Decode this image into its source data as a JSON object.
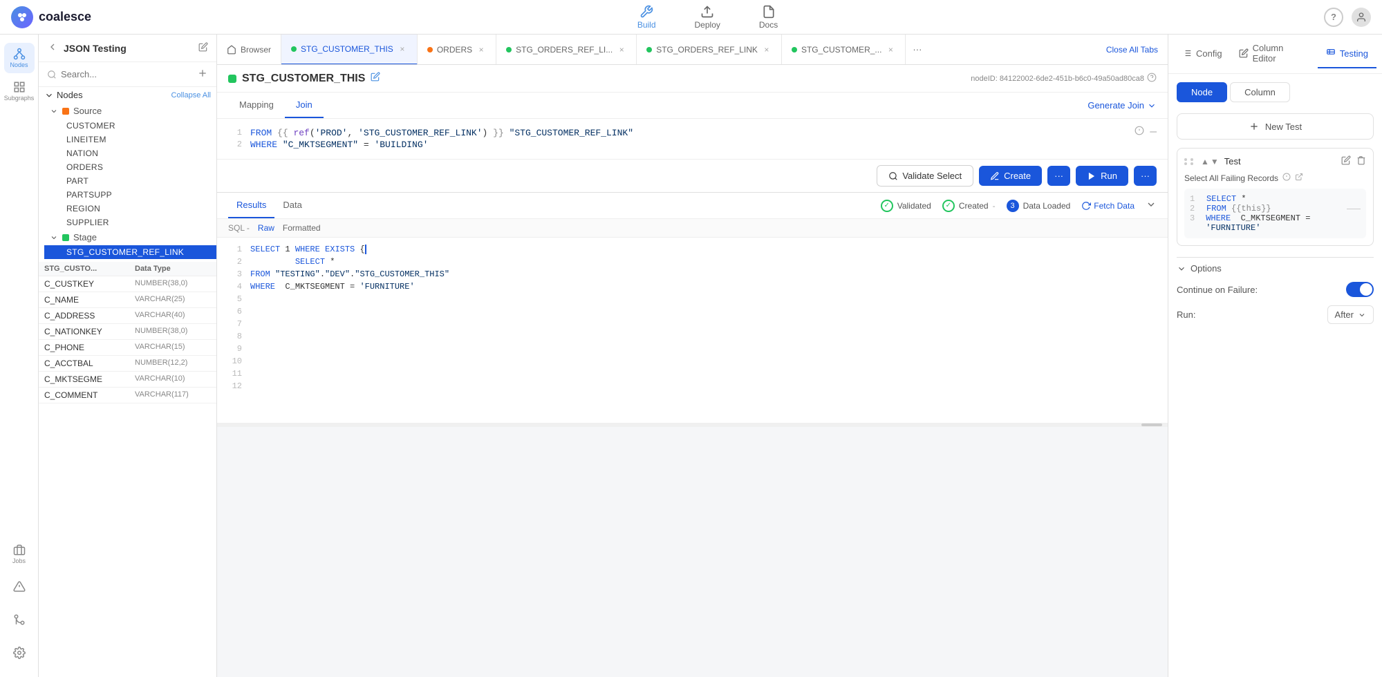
{
  "app": {
    "logo_text": "coalesce",
    "project_name": "JSON Testing"
  },
  "top_nav": {
    "build_label": "Build",
    "deploy_label": "Deploy",
    "docs_label": "Docs"
  },
  "sidebar": {
    "search_placeholder": "Search...",
    "nodes_label": "Nodes",
    "collapse_all_label": "Collapse All",
    "source_label": "Source",
    "stage_label": "Stage",
    "source_items": [
      "CUSTOMER",
      "LINEITEM",
      "NATION",
      "ORDERS",
      "PART",
      "PARTSUPP",
      "REGION",
      "SUPPLIER"
    ],
    "active_node": "STG_CUSTOMER_REF_LINK"
  },
  "table_header": {
    "col1": "STG_CUSTO...",
    "col2": "Data Type"
  },
  "table_rows": [
    {
      "col1": "C_CUSTKEY",
      "col2": "NUMBER(38,0)"
    },
    {
      "col1": "C_NAME",
      "col2": "VARCHAR(25)"
    },
    {
      "col1": "C_ADDRESS",
      "col2": "VARCHAR(40)"
    },
    {
      "col1": "C_NATIONKEY",
      "col2": "NUMBER(38,0)"
    },
    {
      "col1": "C_PHONE",
      "col2": "VARCHAR(15)"
    },
    {
      "col1": "C_ACCTBAL",
      "col2": "NUMBER(12,2)"
    },
    {
      "col1": "C_MKTSEGME",
      "col2": "VARCHAR(10)"
    },
    {
      "col1": "C_COMMENT",
      "col2": "VARCHAR(117)"
    }
  ],
  "tabs": [
    {
      "id": "browser",
      "label": "Browser",
      "dot_color": null,
      "closable": false
    },
    {
      "id": "stg_customer_this",
      "label": "STG_CUSTOMER_THIS",
      "dot_color": "#22c55e",
      "closable": true,
      "active": true
    },
    {
      "id": "orders",
      "label": "ORDERS",
      "dot_color": "#f97316",
      "closable": true
    },
    {
      "id": "stg_orders_ref_li",
      "label": "STG_ORDERS_REF_LI...",
      "dot_color": "#22c55e",
      "closable": true
    },
    {
      "id": "stg_orders_ref_link",
      "label": "STG_ORDERS_REF_LINK",
      "dot_color": "#22c55e",
      "closable": true
    },
    {
      "id": "stg_customer2",
      "label": "STG_CUSTOMER_...",
      "dot_color": "#22c55e",
      "closable": true
    }
  ],
  "close_all_label": "Close All Tabs",
  "editor": {
    "node_title": "STG_CUSTOMER_THIS",
    "node_id": "nodeID: 84122002-6de2-451b-b6c0-49a50ad80ca8",
    "mapping_tab": "Mapping",
    "join_tab": "Join",
    "active_tab": "Join",
    "generate_join_label": "Generate Join",
    "code_lines": [
      {
        "num": 1,
        "content": "FROM {{ ref('PROD', 'STG_CUSTOMER_REF_LINK') }} \"STG_CUSTOMER_REF_LINK\""
      },
      {
        "num": 2,
        "content": "WHERE \"C_MKTSEGMENT\" = 'BUILDING'"
      }
    ]
  },
  "toolbar": {
    "validate_label": "Validate Select",
    "create_label": "Create",
    "run_label": "Run"
  },
  "results": {
    "results_tab": "Results",
    "data_tab": "Data",
    "validated_label": "Validated",
    "created_label": "Created",
    "data_loaded_label": "Data Loaded",
    "data_count": "3",
    "fetch_data_label": "Fetch Data",
    "sql_label": "SQL -",
    "raw_label": "Raw",
    "formatted_label": "Formatted",
    "code_lines": [
      {
        "num": 1,
        "content": "SELECT 1 WHERE EXISTS {"
      },
      {
        "num": 2,
        "content": "         SELECT *"
      },
      {
        "num": 3,
        "content": "FROM \"TESTING\".\"DEV\".\"STG_CUSTOMER_THIS\""
      },
      {
        "num": 4,
        "content": "WHERE  C_MKTSEGMENT = 'FURNITURE'"
      },
      {
        "num": 5,
        "content": ""
      },
      {
        "num": 6,
        "content": ""
      },
      {
        "num": 7,
        "content": ""
      },
      {
        "num": 8,
        "content": ""
      },
      {
        "num": 9,
        "content": ""
      },
      {
        "num": 10,
        "content": ""
      },
      {
        "num": 11,
        "content": ""
      },
      {
        "num": 12,
        "content": ""
      }
    ]
  },
  "right_panel": {
    "config_tab": "Config",
    "column_editor_tab": "Column Editor",
    "testing_tab": "Testing",
    "active_tab": "Testing",
    "node_sub_tab": "Node",
    "column_sub_tab": "Column",
    "active_sub_tab": "Node",
    "new_test_label": "New Test",
    "test_label": "Test",
    "select_all_failing": "Select All Failing Records",
    "sql_lines": [
      {
        "num": 1,
        "content": "SELECT *"
      },
      {
        "num": 2,
        "content": "FROM {{this}}"
      },
      {
        "num": 3,
        "content": "WHERE  C_MKTSEGMENT = 'FURNITURE'"
      }
    ],
    "options_label": "Options",
    "continue_on_failure_label": "Continue on Failure:",
    "run_label": "Run:",
    "run_value": "After"
  }
}
